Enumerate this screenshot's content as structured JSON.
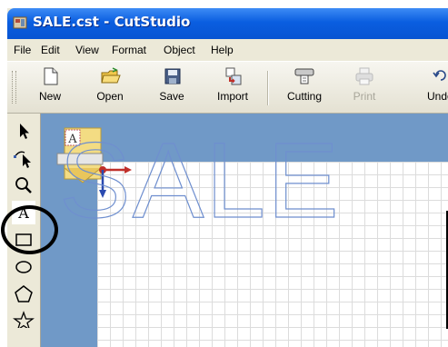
{
  "window": {
    "title": "SALE.cst - CutStudio"
  },
  "menubar": {
    "items": [
      {
        "label": "File",
        "icon": "file-menu"
      },
      {
        "label": "Edit"
      },
      {
        "label": "View"
      },
      {
        "label": "Format"
      },
      {
        "label": "Object"
      },
      {
        "label": "Help"
      }
    ]
  },
  "toolbar": {
    "new_label": "New",
    "open_label": "Open",
    "save_label": "Save",
    "import_label": "Import",
    "cutting_label": "Cutting",
    "print_label": "Print",
    "undo_label": "Undo"
  },
  "tools": {
    "select": "arrow-icon",
    "edit_points": "edit-points-icon",
    "zoom": "magnifier-icon",
    "text": "A",
    "rectangle": "rectangle-icon",
    "ellipse": "ellipse-icon",
    "polygon": "pentagon-icon",
    "star": "star-icon"
  },
  "document": {
    "text": "SALE",
    "outline_color": "#6f8fcf"
  },
  "colors": {
    "titlebar": "#0a5ee0",
    "canvas_background": "#7099c7",
    "highlight": "#000000"
  }
}
